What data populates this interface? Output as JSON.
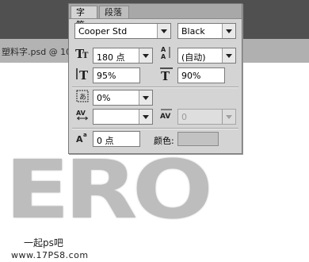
{
  "document": {
    "tab_title": "塑料字.psd @ 10"
  },
  "panel": {
    "tabs": [
      {
        "label": "字符"
      },
      {
        "label": "段落"
      }
    ],
    "font_family": "Cooper Std",
    "font_style": "Black",
    "font_size": "180 点",
    "leading": "(自动)",
    "vertical_scale": "95%",
    "horizontal_scale": "90%",
    "tsume": "0%",
    "kerning": "",
    "tracking": "0",
    "baseline_shift": "0 点",
    "color_label": "颜色:",
    "colors": {
      "swatch": "#c2c2c2"
    }
  },
  "canvas": {
    "text": "ERO"
  },
  "watermark": {
    "line1": "一起ps吧",
    "line2": "www.17PS8.com"
  }
}
